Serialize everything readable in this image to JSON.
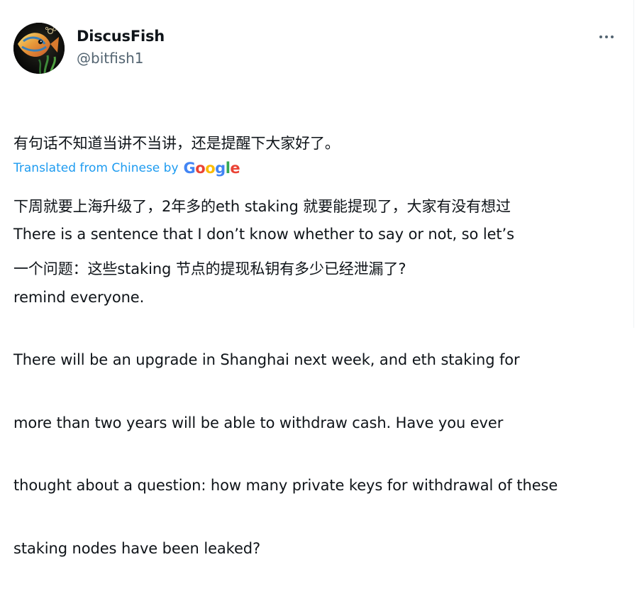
{
  "tweet": {
    "author": {
      "display_name": "DiscusFish",
      "handle": "@bitfish1",
      "avatar_icon": "discus-fish-avatar"
    },
    "more_icon": "more-dots-icon",
    "original_lines": [
      "有句话不知道当讲不当讲，还是提醒下大家好了。",
      "下周就要上海升级了，2年多的eth staking 就要能提现了，大家有没有想过",
      "一个问题：这些staking 节点的提现私钥有多少已经泄漏了?"
    ],
    "translation": {
      "label": "Translated from Chinese by",
      "provider": {
        "letters": [
          "G",
          "o",
          "o",
          "g",
          "l",
          "e"
        ],
        "colors": [
          "#4285F4",
          "#EA4335",
          "#FBBC05",
          "#4285F4",
          "#34A853",
          "#EA4335"
        ]
      },
      "lines": [
        "There is a sentence that I don’t know whether to say or not, so let’s",
        "remind everyone.",
        "There will be an upgrade in Shanghai next week, and eth staking for",
        "more than two years will be able to withdraw cash. Have you ever",
        "thought about a question: how many private keys for withdrawal of these",
        "staking nodes have been leaked?"
      ]
    },
    "colors": {
      "text": "#0f1419",
      "secondary": "#536471",
      "link": "#1d9bf0"
    }
  }
}
